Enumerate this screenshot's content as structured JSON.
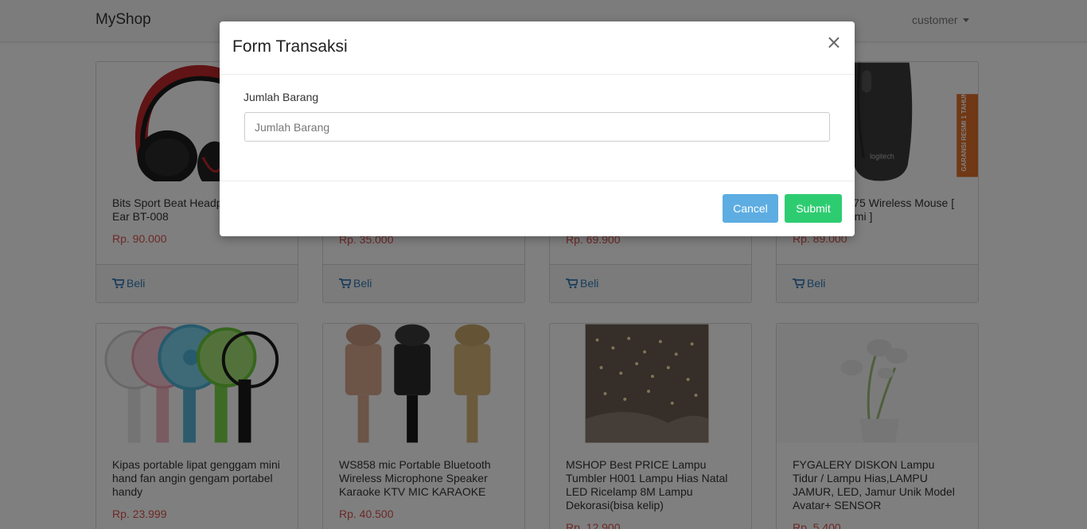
{
  "navbar": {
    "brand": "MyShop",
    "user": "customer"
  },
  "products": [
    {
      "title": "Bits Sport Beat Headphone On Ear BT-008",
      "price": "Rp. 90.000",
      "buy": "Beli"
    },
    {
      "title": "",
      "price": "Rp. 35.000",
      "buy": "Beli"
    },
    {
      "title": "",
      "price": "Rp. 69.900",
      "buy": "Beli"
    },
    {
      "title": "Logitech M175 Wireless Mouse [ Garansi Resmi ]",
      "price": "Rp. 89.000",
      "buy": "Beli"
    },
    {
      "title": "Kipas portable lipat genggam mini hand fan angin gengam portabel handy",
      "price": "Rp. 23.999",
      "buy": "Beli"
    },
    {
      "title": "WS858 mic Portable Bluetooth Wireless Microphone Speaker Karaoke KTV MIC KARAOKE",
      "price": "Rp. 40.500",
      "buy": "Beli"
    },
    {
      "title": "MSHOP Best PRICE Lampu Tumbler H001 Lampu Hias Natal LED Ricelamp 8M Lampu Dekorasi(bisa kelip)",
      "price": "Rp. 12.900",
      "buy": "Beli"
    },
    {
      "title": "FYGALERY DISKON Lampu Tidur / Lampu Hias,LAMPU JAMUR, LED, Jamur Unik Model Avatar+ SENSOR",
      "price": "Rp. 5.400",
      "buy": "Beli"
    }
  ],
  "mouse_badge": "GARANSI RESMI 1 TAHUN",
  "mouse_logo": "logitech",
  "modal": {
    "title": "Form Transaksi",
    "close": "×",
    "field_label": "Jumlah Barang",
    "field_placeholder": "Jumlah Barang",
    "field_value": "",
    "cancel": "Cancel",
    "submit": "Submit"
  },
  "colors": {
    "price": "#d9534f",
    "link": "#337ab7",
    "cancel": "#5dade2",
    "submit": "#2ecc71"
  }
}
